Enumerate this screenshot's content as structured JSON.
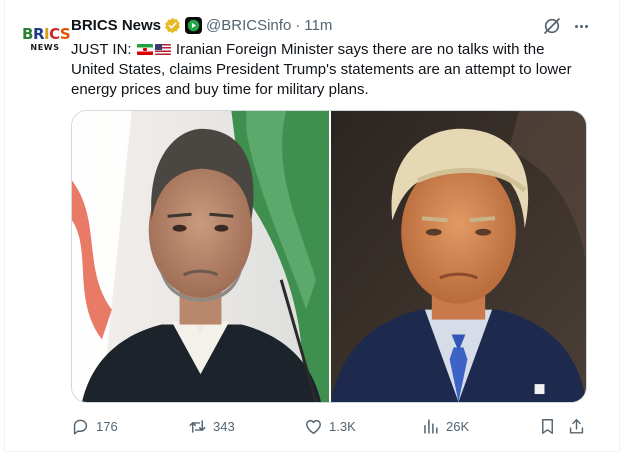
{
  "tweet": {
    "author_name": "BRICS News",
    "handle": "@BRICSinfo",
    "separator": "·",
    "time": "11m",
    "avatar": {
      "line1": "BRICS",
      "line2": "NEWS"
    },
    "text_prefix": "JUST IN:",
    "text_body": "Iranian Foreign Minister says there are no talks with the United States, claims President Trump's statements are an attempt to lower energy prices and buy time for military plans.",
    "flags": [
      "iran-flag",
      "us-flag"
    ],
    "verified_color": "#e8b923",
    "accent": "#1d9bf0"
  },
  "actions": {
    "replies": "176",
    "reposts": "343",
    "likes": "1.3K",
    "views": "26K"
  },
  "icons": {
    "header": [
      "verified-badge-icon",
      "affiliate-badge-icon",
      "grok-icon",
      "more-icon"
    ],
    "actions": [
      "reply-icon",
      "repost-icon",
      "like-icon",
      "views-icon",
      "bookmark-icon",
      "share-icon"
    ]
  }
}
